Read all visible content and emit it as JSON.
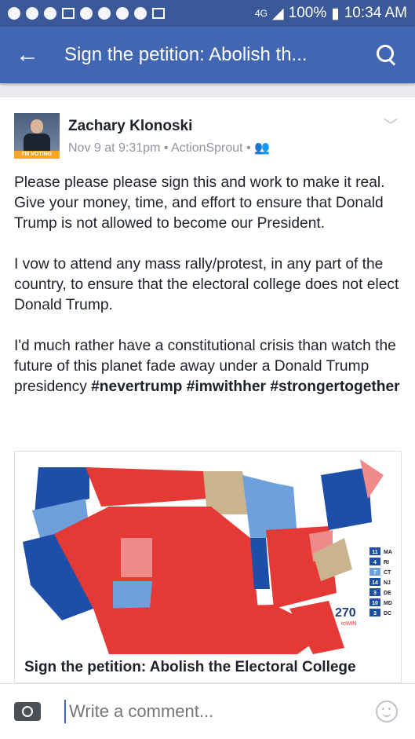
{
  "status_bar": {
    "network": "4G",
    "battery": "100%",
    "time": "10:34 AM"
  },
  "app_bar": {
    "back_icon": "arrow-left-icon",
    "title": "Sign the petition: Abolish th...",
    "search_icon": "search-icon"
  },
  "post": {
    "author": "Zachary Klonoski",
    "avatar_text": "I'M VOTING PRES 97",
    "date": "Nov 9 at 9:31pm",
    "via": "ActionSprout",
    "audience_icon": "friends-icon",
    "paragraphs": [
      "Please please please sign this and work to make it real. Give your money, time, and effort to ensure that Donald Trump is not allowed to become our President.",
      "I vow to attend any mass rally/protest, in any part of the country, to ensure that the electoral college does not elect Donald Trump.",
      "I'd much rather have a constitutional crisis than watch the future of this planet fade away under a Donald Trump presidency"
    ],
    "hashtags": [
      "#nevertrump",
      "#imwithher",
      "#strongertogether"
    ]
  },
  "link_preview": {
    "title": "Sign the petition: Abolish the Electoral College",
    "map_logo": "270",
    "map_logo_sub": "toWIN",
    "map_legend": [
      {
        "value": "11",
        "state": "MA"
      },
      {
        "value": "4",
        "state": "RI"
      },
      {
        "value": "7",
        "state": "CT"
      },
      {
        "value": "14",
        "state": "NJ"
      },
      {
        "value": "3",
        "state": "DE"
      },
      {
        "value": "10",
        "state": "MD"
      },
      {
        "value": "3",
        "state": "DC"
      }
    ],
    "colors": {
      "red": "#e53935",
      "light_red": "#ef8a8a",
      "blue": "#1e4fa8",
      "light_blue": "#6fa0dc",
      "tan": "#c9b48e"
    }
  },
  "composer": {
    "camera_icon": "camera-icon",
    "placeholder": "Write a comment...",
    "emoji_icon": "smiley-icon"
  }
}
